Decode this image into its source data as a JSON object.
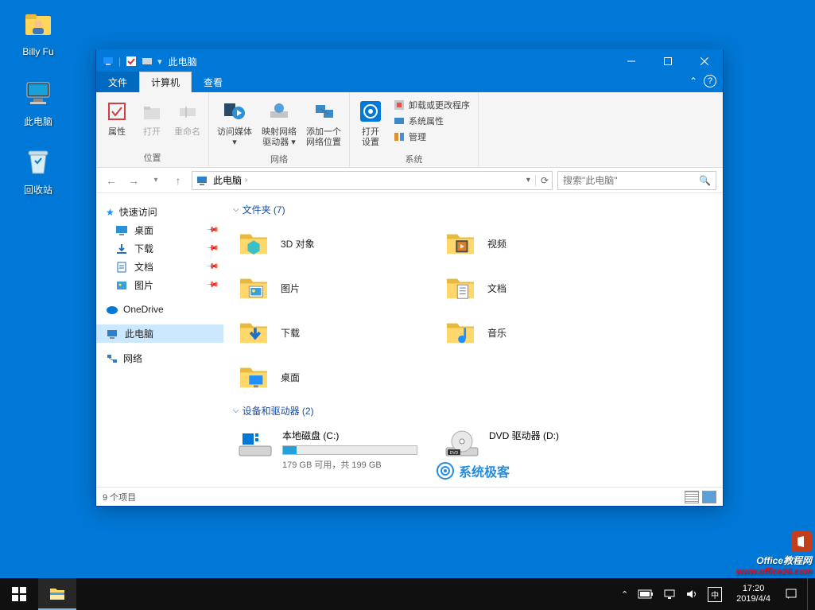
{
  "desktop": {
    "icons": [
      {
        "name": "user-folder-icon",
        "label": "Billy Fu"
      },
      {
        "name": "this-pc-icon",
        "label": "此电脑"
      },
      {
        "name": "recycle-bin-icon",
        "label": "回收站"
      }
    ]
  },
  "window": {
    "title": "此电脑",
    "tabs": {
      "file": "文件",
      "computer": "计算机",
      "view": "查看"
    },
    "ribbon": {
      "group_location": "位置",
      "group_network": "网络",
      "group_system": "系统",
      "properties": "属性",
      "open": "打开",
      "rename": "重命名",
      "media": "访问媒体",
      "map_drive": "映射网络\n驱动器",
      "add_location": "添加一个\n网络位置",
      "open_settings": "打开\n设置",
      "uninstall": "卸载或更改程序",
      "sys_properties": "系统属性",
      "manage": "管理"
    },
    "address": {
      "crumb": "此电脑"
    },
    "search": {
      "placeholder": "搜索\"此电脑\""
    }
  },
  "sidebar": {
    "quick_access": "快速访问",
    "quick_items": [
      {
        "label": "桌面"
      },
      {
        "label": "下载"
      },
      {
        "label": "文档"
      },
      {
        "label": "图片"
      }
    ],
    "onedrive": "OneDrive",
    "this_pc": "此电脑",
    "network": "网络"
  },
  "content": {
    "folders_header": "文件夹 (7)",
    "folders": [
      {
        "label": "3D 对象"
      },
      {
        "label": "视频"
      },
      {
        "label": "图片"
      },
      {
        "label": "文档"
      },
      {
        "label": "下载"
      },
      {
        "label": "音乐"
      },
      {
        "label": "桌面"
      }
    ],
    "drives_header": "设备和驱动器 (2)",
    "drive_c": {
      "label": "本地磁盘 (C:)",
      "sub": "179 GB 可用，共 199 GB",
      "fill_pct": 10
    },
    "drive_d": {
      "label": "DVD 驱动器 (D:)"
    }
  },
  "statusbar": {
    "items": "9 个项目"
  },
  "watermark": {
    "text": "系统极客"
  },
  "taskbar": {
    "time": "17:20",
    "date": "2019/4/4"
  },
  "corner": {
    "l1": "Office教程网",
    "l2": "www.office26.com"
  }
}
